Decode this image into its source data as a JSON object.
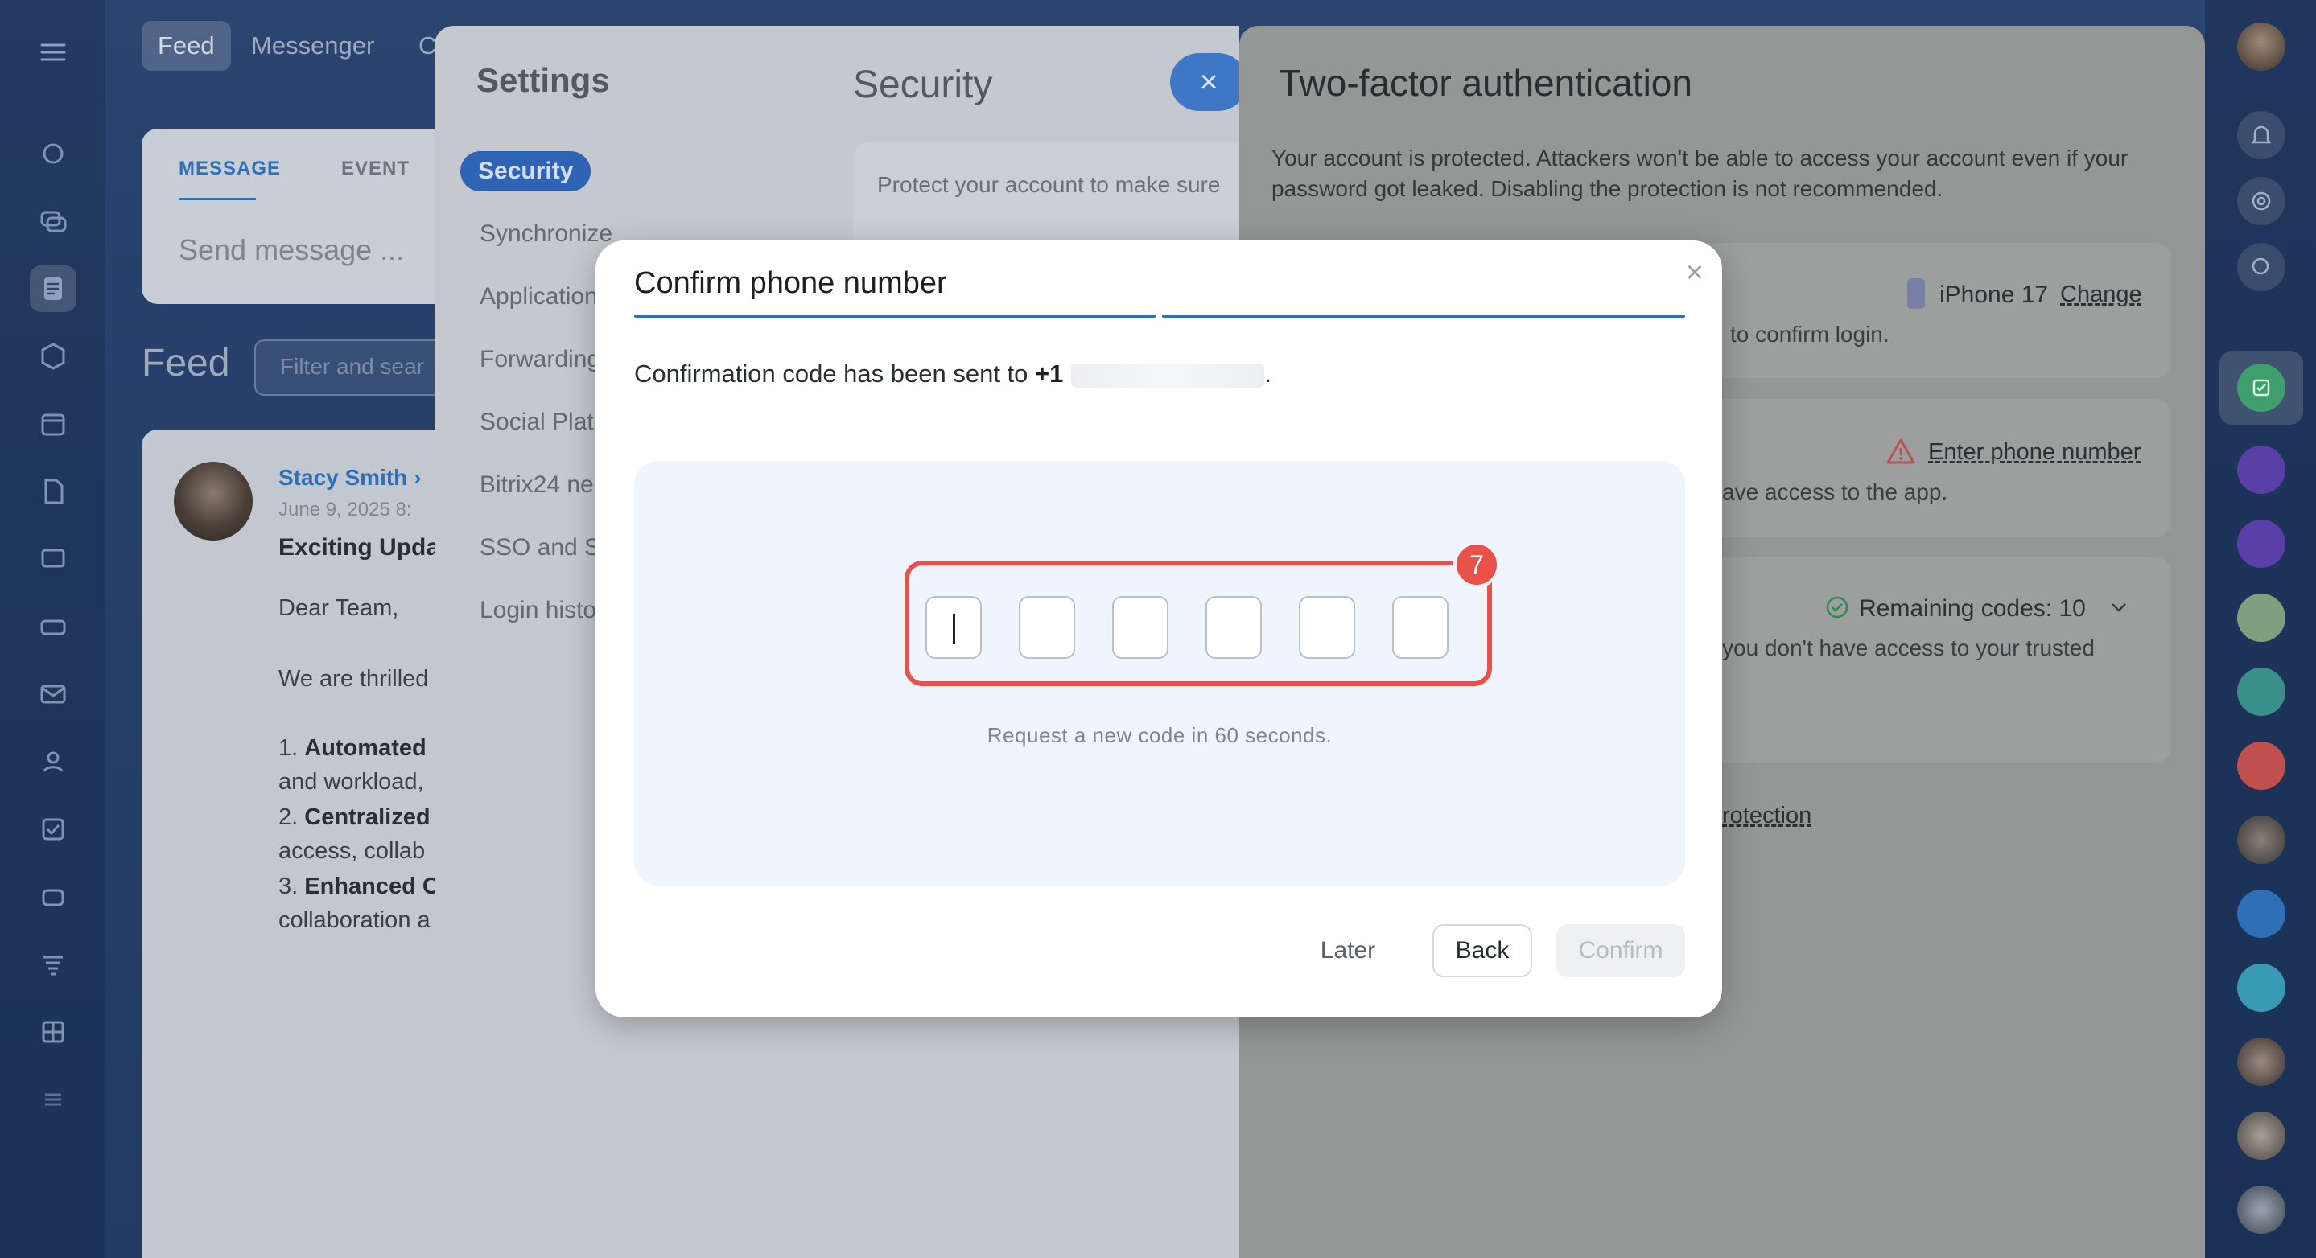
{
  "top_tabs": [
    "Feed",
    "Messenger",
    "C"
  ],
  "composer": {
    "tab_message": "MESSAGE",
    "tab_event": "EVENT",
    "placeholder": "Send message ..."
  },
  "feed": {
    "title": "Feed",
    "filter_placeholder": "Filter and sear"
  },
  "post": {
    "author": "Stacy Smith",
    "author_arrow": "›",
    "date": "June 9, 2025 8:",
    "title": "Exciting Upda",
    "greeting": "Dear Team,",
    "line1": "We are thrilled",
    "item1_num": "1.",
    "item1_bold": "Automated",
    "item1_rest": "and workload,",
    "item2_num": "2.",
    "item2_bold": "Centralized",
    "item2_rest": "access, collab",
    "item3_num": "3.",
    "item3_bold": "Enhanced C",
    "item3_rest": "collaboration a"
  },
  "settings": {
    "title": "Settings",
    "nav": [
      "Security",
      "Synchronize",
      "Application",
      "Forwarding",
      "Social Plat",
      "Bitrix24 ne",
      "SSO and S",
      "Login histo"
    ],
    "security_title": "Security",
    "security_desc": "Protect your account to make sure",
    "close_icon": "×"
  },
  "tfa": {
    "title": "Two-factor authentication",
    "desc": "Your account is protected. Attackers won't be able to access your account even if your password got leaked. Disabling the protection is not recommended.",
    "device": "iPhone 17",
    "change": "Change",
    "confirm_login": "to confirm login.",
    "enter_phone": "Enter phone number",
    "access_app": "ave access to the app.",
    "remaining": "Remaining codes: 10",
    "no_access": "you don't have access to your trusted",
    "protection": "rotection"
  },
  "dialog": {
    "title": "Confirm phone number",
    "message_prefix": "Confirmation code has been sent to",
    "country_code": "+1",
    "message_suffix": ".",
    "resend_text": "Request a new code in 60 seconds.",
    "badge": "7",
    "close_icon": "×",
    "later": "Later",
    "back": "Back",
    "confirm": "Confirm",
    "digits": [
      "",
      "",
      "",
      "",
      "",
      ""
    ]
  },
  "colors": {
    "accent": "#2f6fb8",
    "highlight": "#e8524a",
    "code_bg": "#eef5fd"
  }
}
